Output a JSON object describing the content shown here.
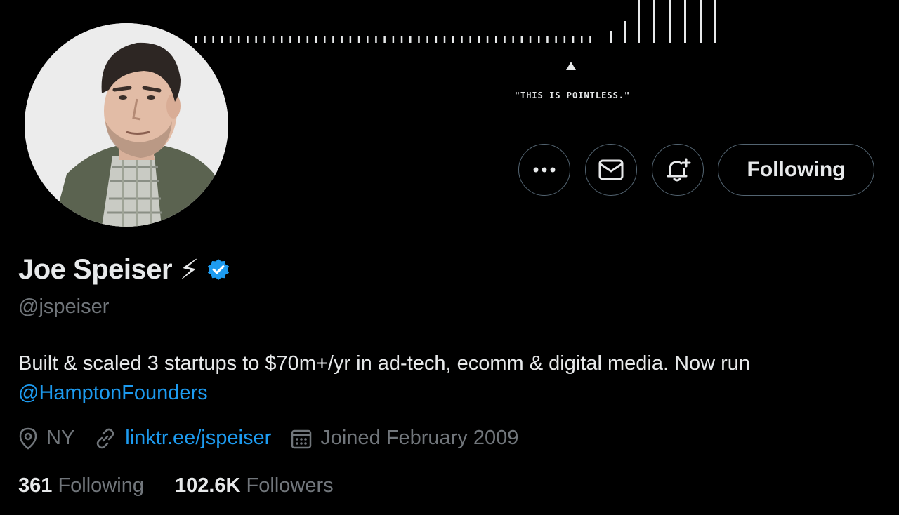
{
  "banner": {
    "caption": "\"THIS IS POINTLESS.\""
  },
  "actions": {
    "more_icon": "more-icon",
    "message_icon": "mail-icon",
    "notify_icon": "bell-plus-icon",
    "follow_label": "Following"
  },
  "profile": {
    "display_name": "Joe Speiser",
    "emoji": "⚡",
    "handle": "@jspeiser",
    "bio_text": "Built & scaled 3 startups to $70m+/yr in ad-tech, ecomm & digital media. Now run",
    "bio_mention": "@HamptonFounders",
    "location": "NY",
    "website": "linktr.ee/jspeiser",
    "joined": "Joined February 2009",
    "following_count": "361",
    "following_label": "Following",
    "followers_count": "102.6K",
    "followers_label": "Followers"
  },
  "colors": {
    "accent": "#1d9bf0",
    "muted": "#71767b",
    "text": "#e7e9ea",
    "bg": "#000000"
  }
}
